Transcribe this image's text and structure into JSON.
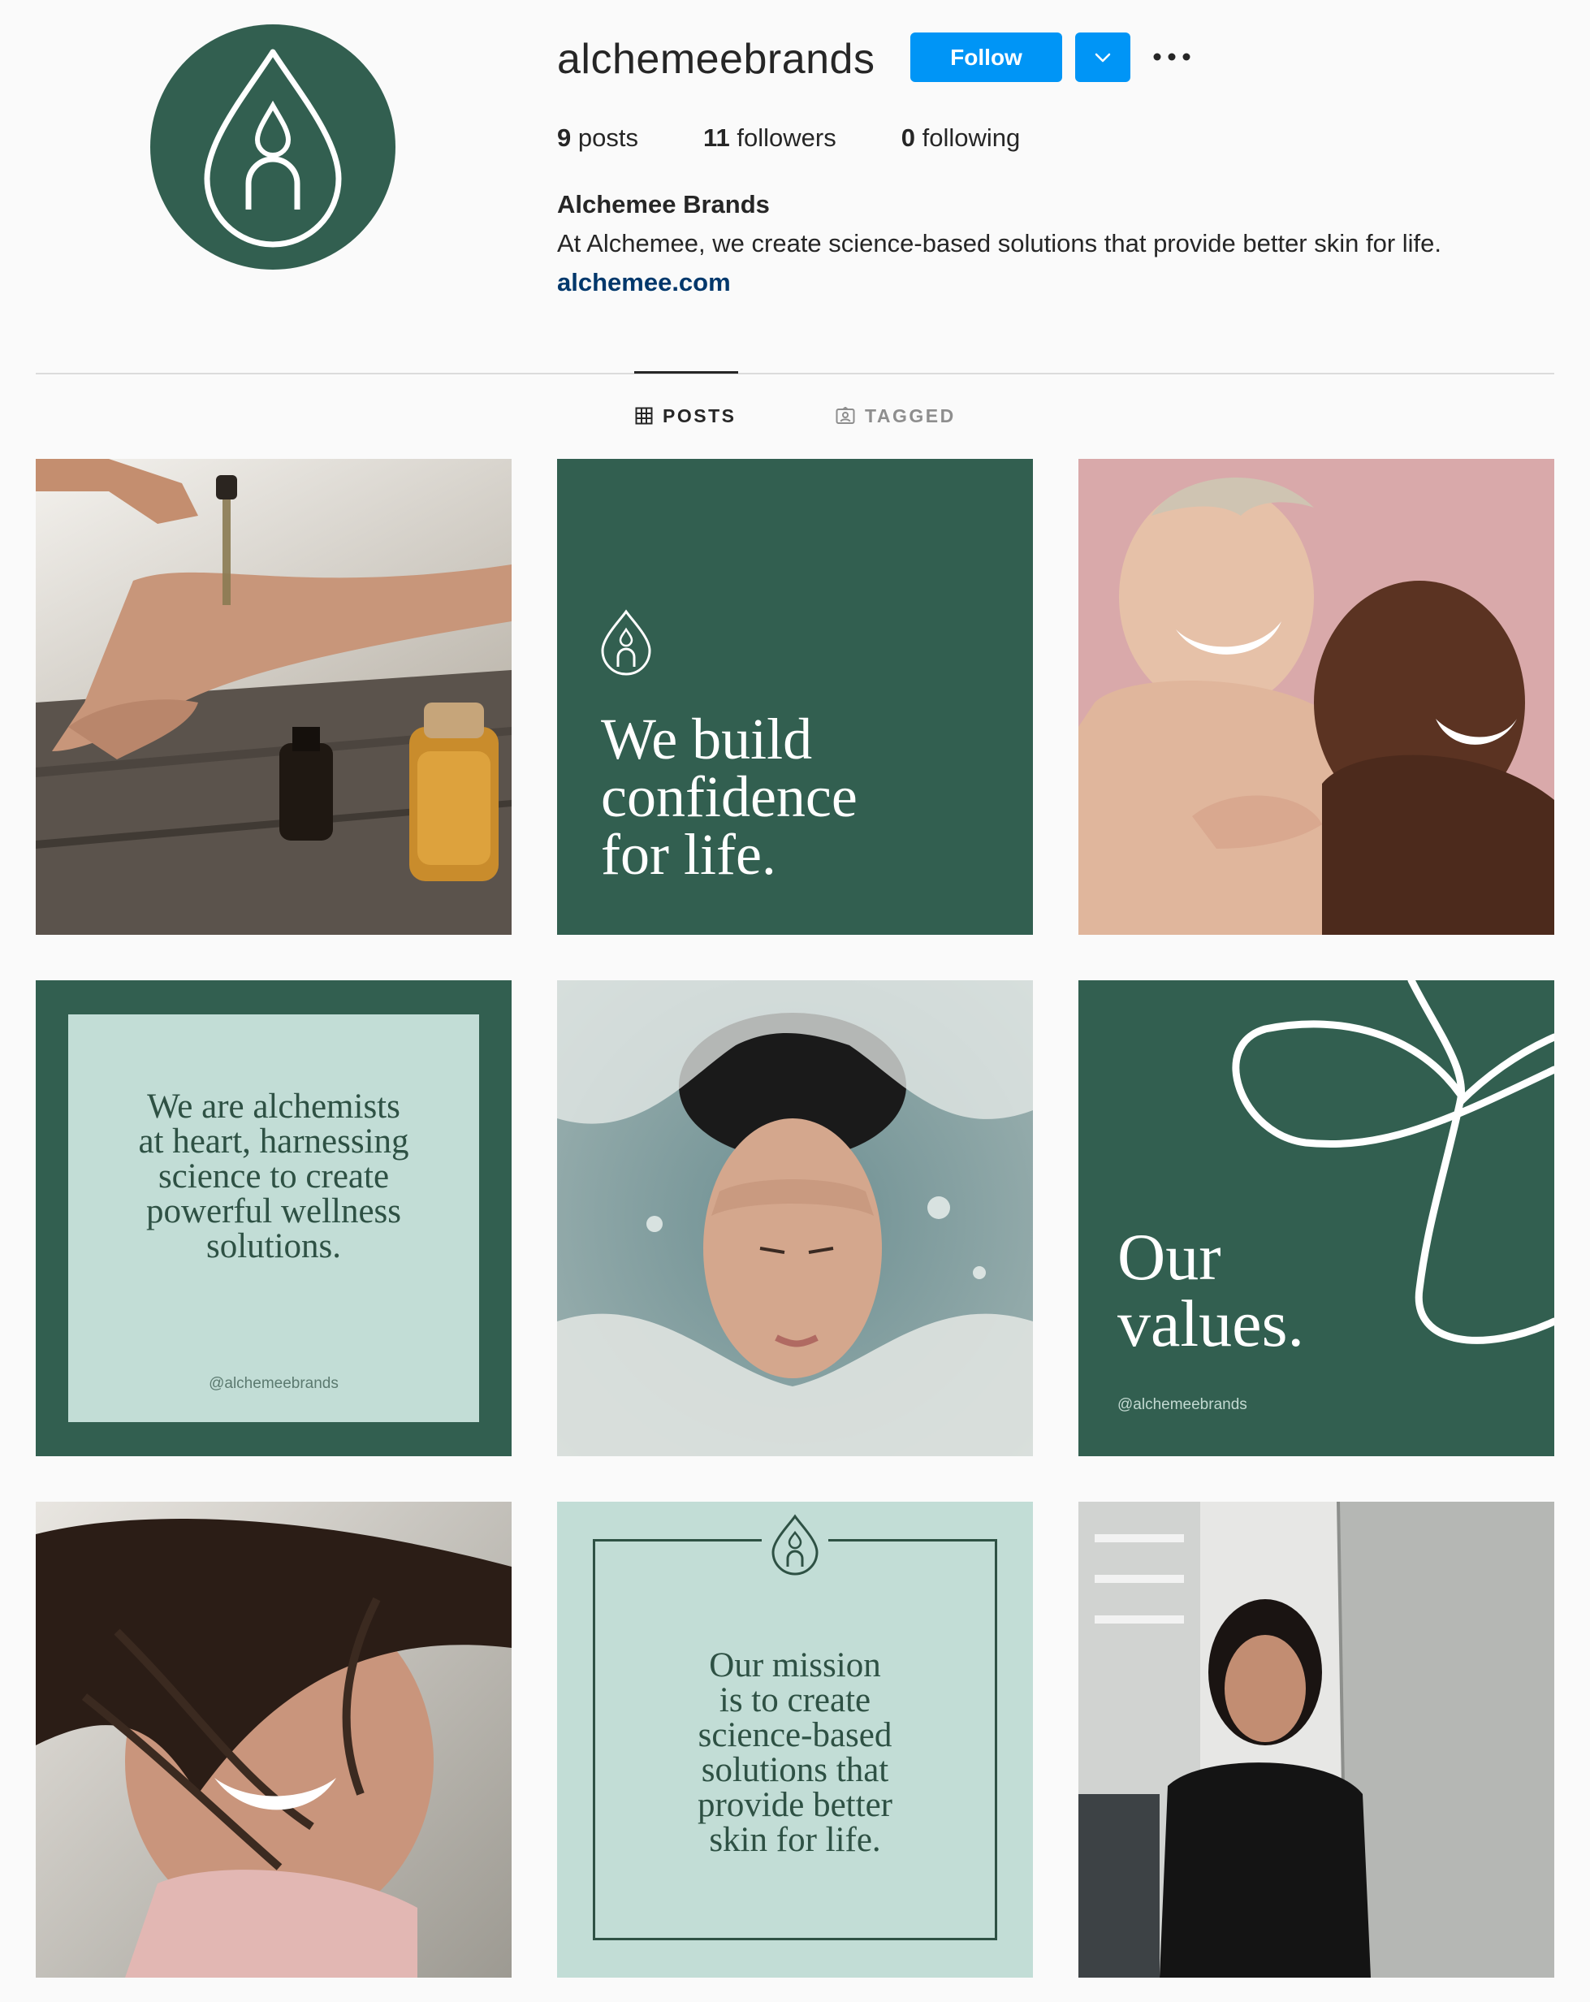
{
  "profile": {
    "username": "alchemeebrands",
    "follow_label": "Follow",
    "dropdown_icon": "chevron-down-icon",
    "more_icon": "more-options-icon",
    "stats": {
      "posts_count": "9",
      "posts_label": "posts",
      "followers_count": "11",
      "followers_label": "followers",
      "following_count": "0",
      "following_label": "following"
    },
    "full_name": "Alchemee Brands",
    "bio": "At Alchemee, we create science-based solutions that provide better skin for life.",
    "website": "alchemee.com"
  },
  "tabs": {
    "posts_label": "POSTS",
    "tagged_label": "TAGGED"
  },
  "posts": {
    "p2_text": "We build\nconfidence\nfor life.",
    "p4_text": "We are alchemists\nat heart, harnessing\nscience to create\npowerful wellness\nsolutions.",
    "p4_handle": "@alchemeebrands",
    "p6_text": "Our\nvalues.",
    "p6_handle": "@alchemeebrands",
    "p8_text": "Our mission\nis to create\nscience-based\nsolutions that\nprovide better\nskin for life."
  },
  "colors": {
    "brand_green": "#325f50",
    "mint": "#c2ddd6",
    "follow_blue": "#0095f6",
    "link_blue": "#00376b"
  }
}
